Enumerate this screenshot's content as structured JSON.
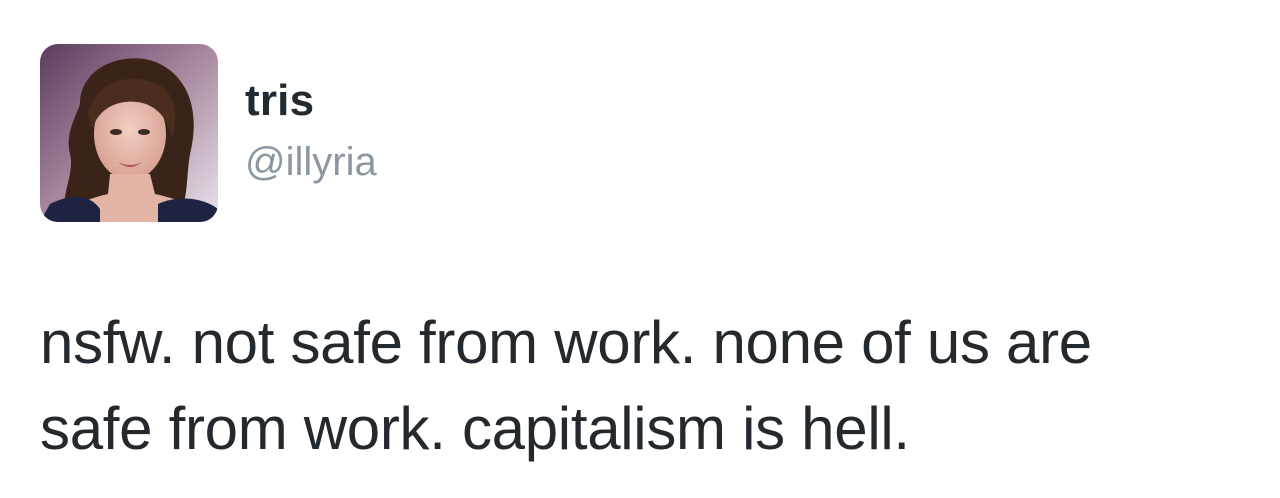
{
  "tweet": {
    "author": {
      "display_name": "tris",
      "handle": "@illyria",
      "avatar_icon": "profile-photo"
    },
    "text_lines": [
      "nsfw. not safe from work. none of us are",
      "safe from work. capitalism is hell."
    ]
  },
  "colors": {
    "background": "#ffffff",
    "name": "#222a30",
    "handle": "#8b98a3",
    "text": "#24292e"
  }
}
